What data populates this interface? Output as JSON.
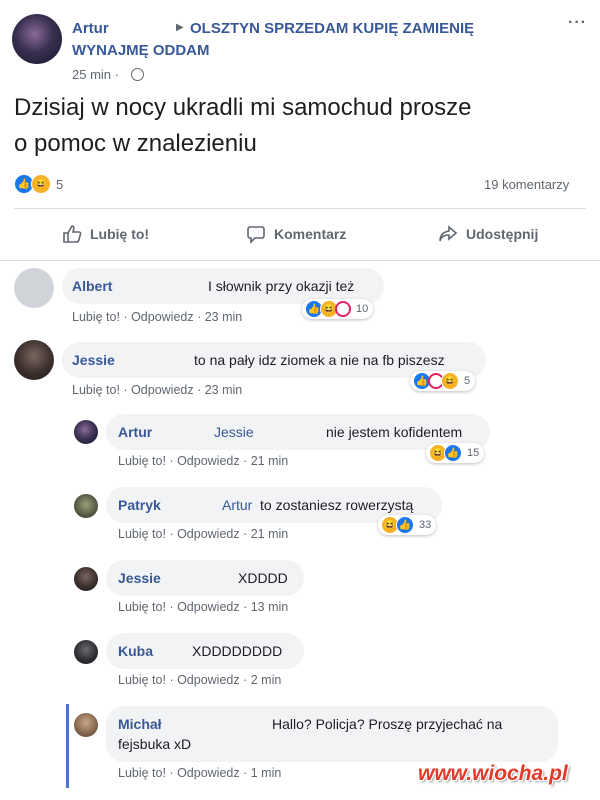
{
  "post": {
    "author": "Artur",
    "group_arrow": "▶",
    "group_line1": "OLSZTYN SPRZEDAM KUPIĘ ZAMIENIĘ",
    "group_line2": "WYNAJMĘ ODDAM",
    "time": "25 min ·",
    "more": "···",
    "text_line1": "Dzisiaj w nocy ukradli mi samochud prosze",
    "text_line2": "o pomoc w znalezieniu",
    "reaction_count": "5",
    "comments_count": "19 komentarzy"
  },
  "actions": {
    "like": "Lubię to!",
    "comment": "Komentarz",
    "share": "Udostępnij"
  },
  "comments": [
    {
      "name": "Albert",
      "text": "I słownik przy okazji też",
      "like": "Lubię to!",
      "reply": "Odpowiedz",
      "time": "23 min",
      "count": "10"
    },
    {
      "name": "Jessie",
      "text": "to na pały idz ziomek a nie na fb piszesz",
      "like": "Lubię to!",
      "reply": "Odpowiedz",
      "time": "23 min",
      "count": "5"
    },
    {
      "name": "Artur",
      "mention": "Jessie",
      "text": "nie jestem kofidentem",
      "like": "Lubię to!",
      "reply": "Odpowiedz",
      "time": "21 min",
      "count": "15"
    },
    {
      "name": "Patryk",
      "mention": "Artur",
      "text": "to zostaniesz rowerzystą",
      "like": "Lubię to!",
      "reply": "Odpowiedz",
      "time": "21 min",
      "count": "33"
    },
    {
      "name": "Jessie",
      "text": "XDDDD",
      "like": "Lubię to!",
      "reply": "Odpowiedz",
      "time": "13 min"
    },
    {
      "name": "Kuba",
      "text": "XDDDDDDDD",
      "like": "Lubię to!",
      "reply": "Odpowiedz",
      "time": "2 min"
    },
    {
      "name": "Michał",
      "text_line1": "Hallo? Policja? Proszę przyjechać na",
      "text_line2": "fejsbuka xD",
      "like": "Lubię to!",
      "reply": "Odpowiedz",
      "time": "1 min"
    }
  ],
  "watermark": "www.wiocha.pl",
  "colors": {
    "link": "#385898",
    "like": "#1877f2",
    "haha": "#f7b125",
    "love": "#e0245e",
    "bubble": "#f2f3f5"
  }
}
